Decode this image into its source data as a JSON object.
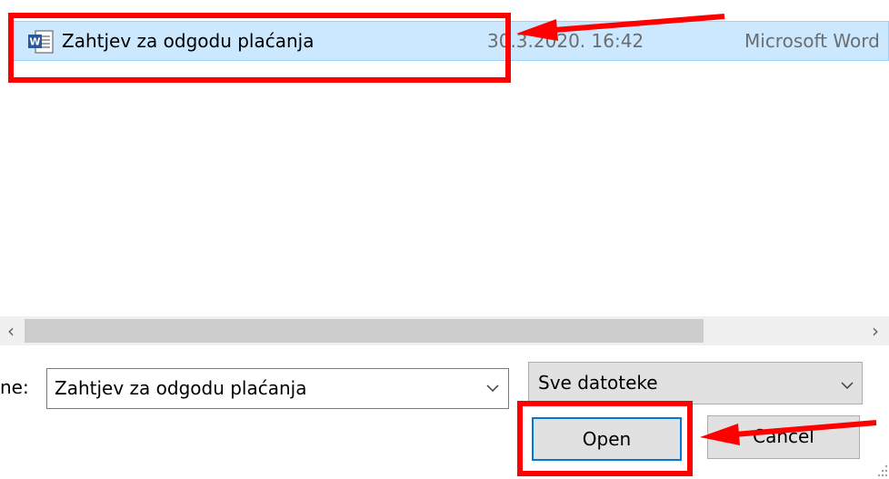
{
  "file_list": {
    "rows": [
      {
        "name": "Zahtjev za odgodu plaćanja",
        "date": "30.3.2020. 16:42",
        "type": "Microsoft Word",
        "icon": "word-document-icon"
      }
    ]
  },
  "scrollbar": {
    "left_arrow": "‹",
    "right_arrow": "›"
  },
  "file_name": {
    "label": "ne:",
    "value": "Zahtjev za odgodu plaćanja"
  },
  "file_type": {
    "value": "Sve datoteke"
  },
  "buttons": {
    "open": "Open",
    "cancel": "Cancel"
  },
  "colors": {
    "selection": "#cce8ff",
    "annotation": "#ff0000",
    "focus": "#0078d7"
  }
}
